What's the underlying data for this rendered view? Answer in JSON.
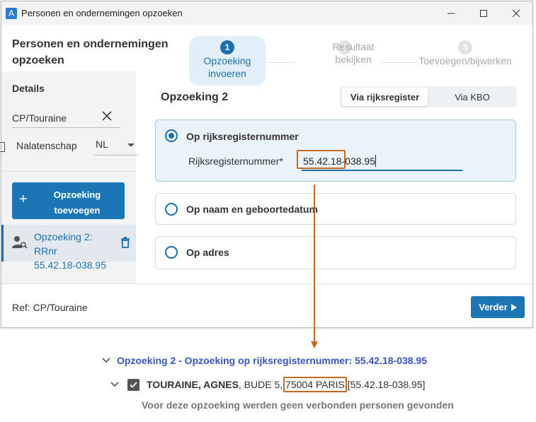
{
  "window": {
    "title": "Personen en ondernemingen opzoeken",
    "app_icon_letter": "A"
  },
  "header": {
    "title": "Personen en ondernemingen opzoeken",
    "steps": [
      {
        "number": "1",
        "label": "Opzoeking invoeren",
        "active": true
      },
      {
        "number": "2",
        "label": "Resultaat bekijken",
        "active": false
      },
      {
        "number": "3",
        "label": "Toevoegen/bijwerken",
        "active": false
      }
    ]
  },
  "sidebar": {
    "heading": "Details",
    "case_value": "CP/Touraine",
    "estate_label": "Nalatenschap",
    "language": "NL",
    "add_button_label": "Opzoeking toevoegen",
    "search_item": {
      "line1": "Opzoeking 2: RRnr",
      "line2": "55.42.18-038.95"
    }
  },
  "content": {
    "title": "Opzoeking 2",
    "toggle": {
      "options": [
        "Via rijksregister",
        "Via KBO"
      ],
      "selected": "Via rijksregister"
    },
    "options": [
      {
        "label": "Op rijksregisternummer",
        "selected": true
      },
      {
        "label": "Op naam en geboortedatum",
        "selected": false
      },
      {
        "label": "Op adres",
        "selected": false
      }
    ],
    "rr_field_label": "Rijksregisternummer*",
    "rr_field_value": "55.42.18-038.95"
  },
  "footer": {
    "ref": "Ref: CP/Touraine",
    "next_label": "Verder"
  },
  "results": {
    "group_title": "Opzoeking 2 - Opzoeking op rijksregisternummer: 55.42.18-038.95",
    "person_name": "TOURAINE, AGNES",
    "person_street": ", BUDE 5,",
    "person_city": "75004 PARIS",
    "person_rr": "[55.42.18-038.95]",
    "no_related_text": "Voor deze opzoeking werden geen verbonden personen gevonden"
  },
  "colors": {
    "accent": "#1c76b6",
    "highlight": "#c76a1f",
    "result_link": "#3a55c9"
  }
}
